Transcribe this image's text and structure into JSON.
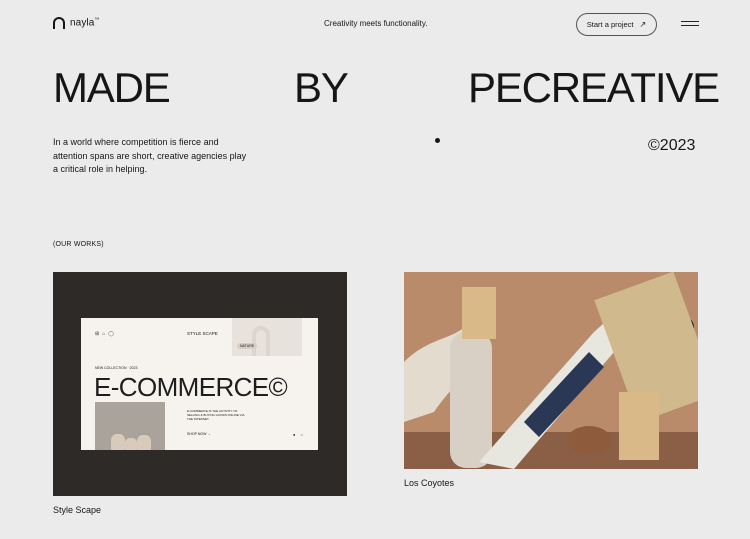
{
  "header": {
    "logo_text": "nayla",
    "logo_mark": "™",
    "tagline": "Creativity meets functionality.",
    "cta_label": "Start a project",
    "cta_icon": "arrow-up-right-icon",
    "menu_icon": "hamburger-icon"
  },
  "hero": {
    "words": [
      "MADE",
      "BY",
      "PECREATIVE"
    ],
    "intro": "In a world where competition is fierce and attention spans are short, creative agencies play a critical role in helping.",
    "year": "©2023"
  },
  "works": {
    "label": "(OUR WORKS)",
    "items": [
      {
        "title": "Style Scape",
        "mockup": {
          "nav": "STYLE SCAPE",
          "pill": "NATURE",
          "sub": "NEW COLLECTION · 2023",
          "headline": "E-COMMERCE©",
          "copy": "E-COMMERCE IS THE ACTIVITY OF SELLING & BUYING GOODS ONLINE VIA THE INTERNET.",
          "link": "SHOP NOW →"
        }
      },
      {
        "title": "Los Coyotes"
      }
    ]
  },
  "colors": {
    "background": "#ebebeb",
    "text": "#161616",
    "card_dark": "#2e2a27",
    "photo_warm": "#b98b6b"
  }
}
